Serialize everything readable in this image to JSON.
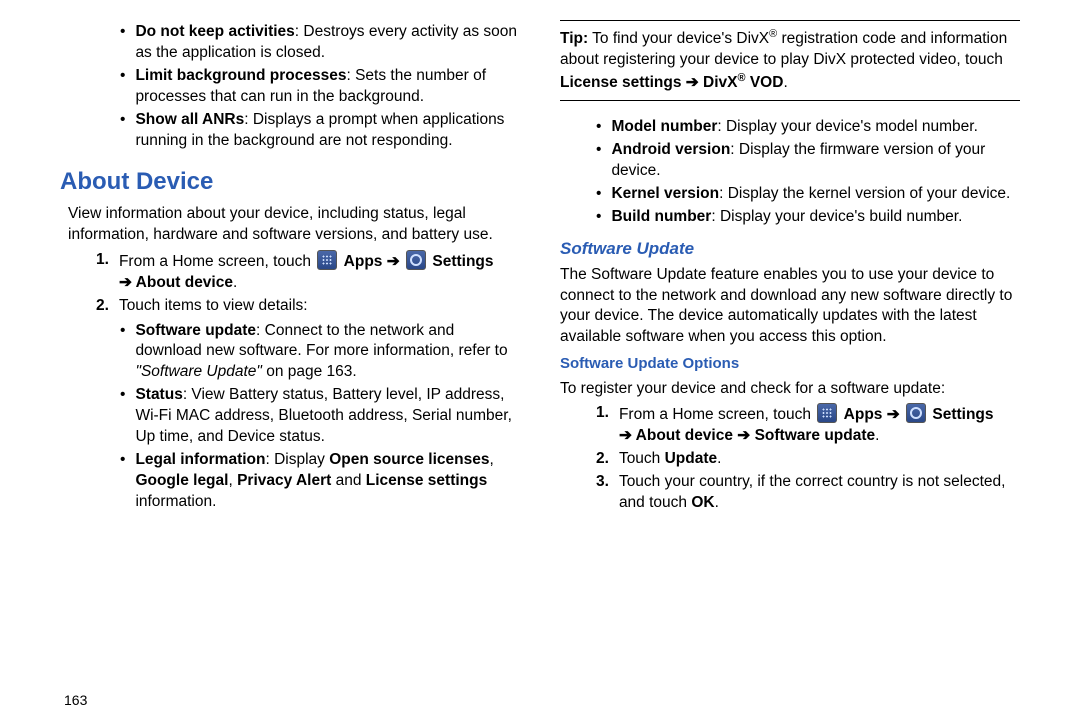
{
  "page_number": "163",
  "left": {
    "bullets_top": [
      {
        "lead": "Do not keep activities",
        "rest": ": Destroys every activity as soon as the application is closed."
      },
      {
        "lead": "Limit background processes",
        "rest": ": Sets the number of processes that can run in the background."
      },
      {
        "lead": "Show all ANRs",
        "rest": ": Displays a prompt when applications running in the background are not responding."
      }
    ],
    "h1": "About Device",
    "intro": "View information about your device, including status, legal information, hardware and software versions, and battery use.",
    "step1_lead": "From a Home screen, touch",
    "step1_apps": "Apps",
    "step1_arrow": "➔",
    "step1_settings": "Settings",
    "step1_line2": "➔ About device",
    "step1_period": ".",
    "step2": "Touch items to view details:",
    "details": [
      {
        "lead": "Software update",
        "rest": ": Connect to the network and download new software. For more information, refer to ",
        "ital": "\"Software Update\"",
        "post": " on page 163."
      },
      {
        "lead": "Status",
        "rest": ": View Battery status, Battery level, IP address, Wi-Fi MAC address, Bluetooth address, Serial number, Up time, and Device status."
      }
    ],
    "legal_lead": "Legal information",
    "legal_seg1": ": Display ",
    "legal_b1": "Open source licenses",
    "legal_seg2": ", ",
    "legal_b2": "Google legal",
    "legal_seg3": ", ",
    "legal_b3": "Privacy Alert",
    "legal_seg4": " and ",
    "legal_b4": "License settings",
    "legal_seg5": " information."
  },
  "right": {
    "tip_lead": "Tip:",
    "tip_line1a": " To find your device's DivX",
    "tip_reg": "®",
    "tip_line1b": " registration code and information about registering your device to play DivX protected video, touch ",
    "tip_b1": "License settings ➔ DivX",
    "tip_b2": " VOD",
    "tip_period": ".",
    "bullets2": [
      {
        "lead": "Model number",
        "rest": ": Display your device's model number."
      },
      {
        "lead": "Android version",
        "rest": ": Display the firmware version of your device."
      },
      {
        "lead": "Kernel version",
        "rest": ": Display the kernel version of your device."
      },
      {
        "lead": "Build number",
        "rest": ": Display your device's build number."
      }
    ],
    "h2": "Software Update",
    "para": "The Software Update feature enables you to use your device to connect to the network and download any new software directly to your device. The device automatically updates with the latest available software when you access this option.",
    "h3": "Software Update Options",
    "reg_line": "To register your device and check for a software update:",
    "s1_lead": "From a Home screen, touch",
    "s1_apps": "Apps",
    "s1_arrow": "➔",
    "s1_settings": "Settings",
    "s1_line2": "➔ About device ➔ Software update",
    "s1_period": ".",
    "s2a": "Touch ",
    "s2b": "Update",
    "s2c": ".",
    "s3a": "Touch your country, if the correct country is not selected, and touch ",
    "s3b": "OK",
    "s3c": "."
  }
}
